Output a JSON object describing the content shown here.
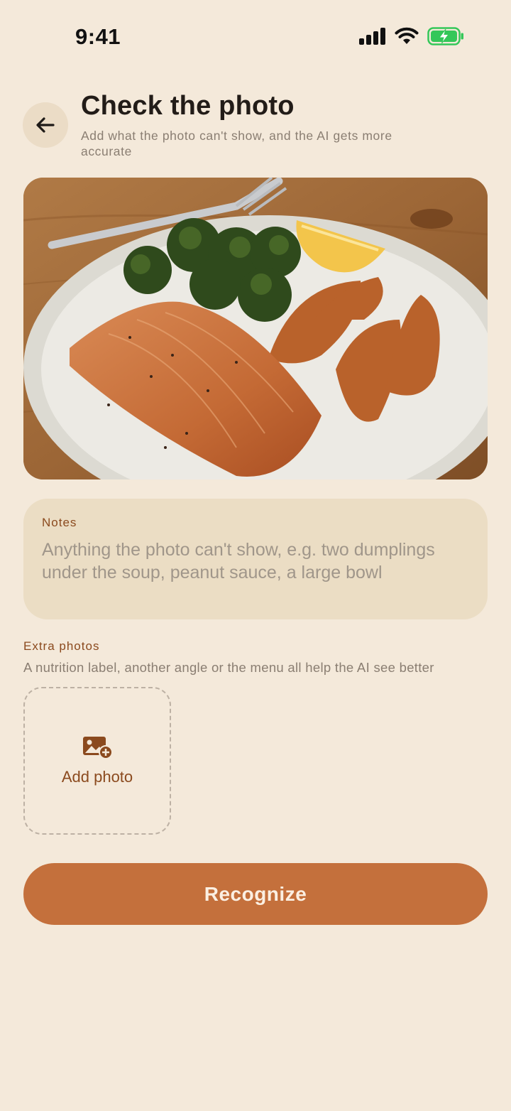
{
  "status_bar": {
    "time": "9:41",
    "icons": [
      "cellular-signal-icon",
      "wifi-icon",
      "battery-charging-icon"
    ]
  },
  "header": {
    "back_icon": "arrow-left-icon",
    "title": "Check the photo",
    "subtitle": "Add what the photo can't show, and the AI gets more accurate"
  },
  "photo": {
    "description_icon": "meal-photo"
  },
  "notes": {
    "label": "Notes",
    "value": "",
    "placeholder": "Anything the photo can't show, e.g. two dumplings under the soup, peanut sauce, a large bowl"
  },
  "extra_photos": {
    "label": "Extra photos",
    "help": "A nutrition label, another angle or the menu all help the AI see better",
    "add_label": "Add photo",
    "add_icon": "add-image-icon"
  },
  "primary_action": {
    "label": "Recognize"
  },
  "colors": {
    "background": "#F4E9DA",
    "accent": "#C4703C",
    "label_brown": "#8B4A1E",
    "card": "#EBDDC4",
    "muted_text": "#8A7E72",
    "battery_green": "#34C759"
  }
}
